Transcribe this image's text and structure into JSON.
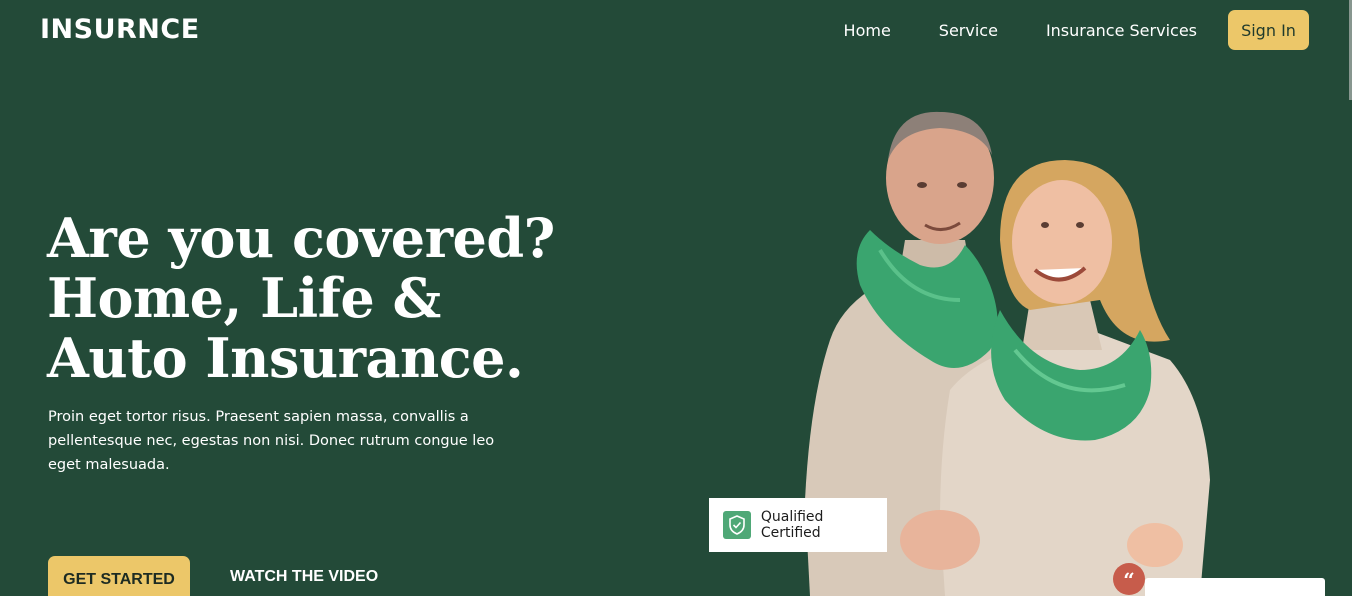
{
  "header": {
    "logo": "INSURNCE",
    "nav": [
      "Home",
      "Service",
      "Insurance Services"
    ],
    "signin_label": "Sign In"
  },
  "hero": {
    "title_lines": [
      "Are you covered?",
      "Home, Life &",
      "Auto Insurance."
    ],
    "description": "Proin eget tortor risus. Praesent sapien massa, convallis a pellentesque nec, egestas non nisi. Donec rutrum congue leo eget malesuada.",
    "cta_primary": "GET STARTED",
    "cta_secondary": "WATCH THE VIDEO"
  },
  "badge": {
    "text": "Qualified Certified",
    "icon": "shield-check-icon"
  },
  "quote": {
    "glyph": "“",
    "icon": "quote-icon"
  },
  "colors": {
    "background": "#234a38",
    "accent": "#ecc769",
    "badge_icon": "#4fa877",
    "quote": "#c75c4b"
  }
}
